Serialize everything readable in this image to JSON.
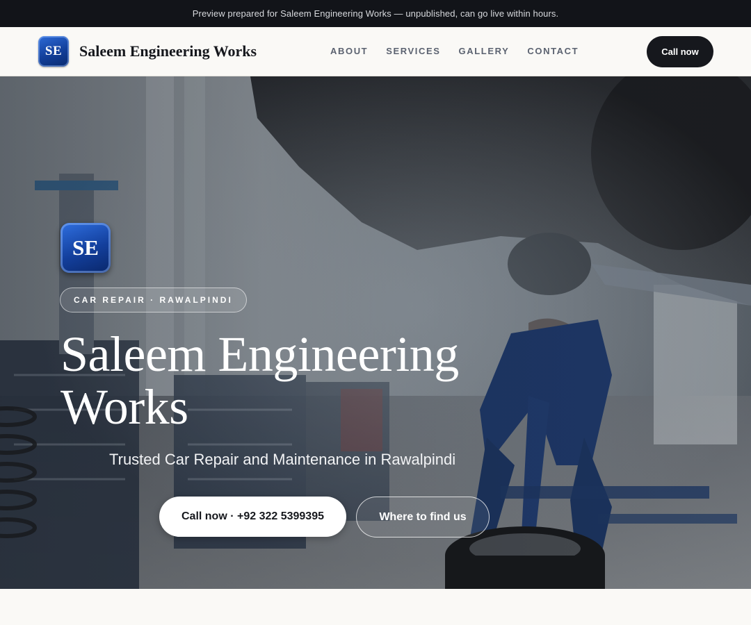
{
  "banner": {
    "text": "Preview prepared for Saleem Engineering Works — unpublished, can go live within hours."
  },
  "header": {
    "logo_initials": "SE",
    "brand_name": "Saleem Engineering Works",
    "nav": [
      {
        "label": "ABOUT"
      },
      {
        "label": "SERVICES"
      },
      {
        "label": "GALLERY"
      },
      {
        "label": "CONTACT"
      }
    ],
    "cta_label": "Call now"
  },
  "hero": {
    "logo_initials": "SE",
    "eyebrow": "CAR REPAIR · RAWALPINDI",
    "title": "Saleem Engineering Works",
    "subtitle": "Trusted Car Repair and Maintenance in Rawalpindi",
    "primary_button": "Call now · +92 322 5399395",
    "secondary_button": "Where to find us"
  },
  "colors": {
    "topbar_bg": "#121419",
    "nav_bg": "#faf9f6",
    "cta_bg": "#16181d",
    "logo_blue": "#123f9a"
  }
}
